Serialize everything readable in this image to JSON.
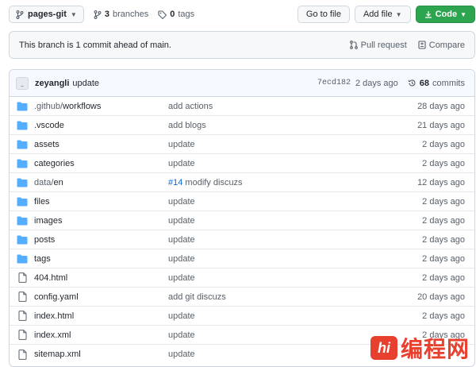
{
  "toolbar": {
    "branch": "pages-git",
    "branches_count": "3",
    "branches_label": "branches",
    "tags_count": "0",
    "tags_label": "tags",
    "go_to_file": "Go to file",
    "add_file": "Add file",
    "code": "Code"
  },
  "banner": {
    "text": "This branch is 1 commit ahead of main.",
    "pull_request": "Pull request",
    "compare": "Compare"
  },
  "latest_commit": {
    "author": "zeyangli",
    "message": "update",
    "sha": "7ecd182",
    "age": "2 days ago",
    "commits_count": "68",
    "commits_label": "commits"
  },
  "files": [
    {
      "type": "dir",
      "prefix": ".github/",
      "name": "workflows",
      "message": "add actions",
      "age": "28 days ago"
    },
    {
      "type": "dir",
      "prefix": "",
      "name": ".vscode",
      "message": "add blogs",
      "age": "21 days ago"
    },
    {
      "type": "dir",
      "prefix": "",
      "name": "assets",
      "message": "update",
      "age": "2 days ago"
    },
    {
      "type": "dir",
      "prefix": "",
      "name": "categories",
      "message": "update",
      "age": "2 days ago"
    },
    {
      "type": "dir",
      "prefix": "data/",
      "name": "en",
      "issue": "#14",
      "message": "modify discuzs",
      "age": "12 days ago"
    },
    {
      "type": "dir",
      "prefix": "",
      "name": "files",
      "message": "update",
      "age": "2 days ago"
    },
    {
      "type": "dir",
      "prefix": "",
      "name": "images",
      "message": "update",
      "age": "2 days ago"
    },
    {
      "type": "dir",
      "prefix": "",
      "name": "posts",
      "message": "update",
      "age": "2 days ago"
    },
    {
      "type": "dir",
      "prefix": "",
      "name": "tags",
      "message": "update",
      "age": "2 days ago"
    },
    {
      "type": "file",
      "prefix": "",
      "name": "404.html",
      "message": "update",
      "age": "2 days ago"
    },
    {
      "type": "file",
      "prefix": "",
      "name": "config.yaml",
      "message": "add git discuzs",
      "age": "20 days ago"
    },
    {
      "type": "file",
      "prefix": "",
      "name": "index.html",
      "message": "update",
      "age": "2 days ago"
    },
    {
      "type": "file",
      "prefix": "",
      "name": "index.xml",
      "message": "update",
      "age": "2 days ago"
    },
    {
      "type": "file",
      "prefix": "",
      "name": "sitemap.xml",
      "message": "update",
      "age": ""
    }
  ],
  "watermark": {
    "logo_text": "hi",
    "site_name": "编程网"
  },
  "colors": {
    "folder": "#54aeff",
    "file": "#57606a",
    "primary": "#2da44e",
    "link": "#0969da",
    "watermark": "#e8402f"
  }
}
